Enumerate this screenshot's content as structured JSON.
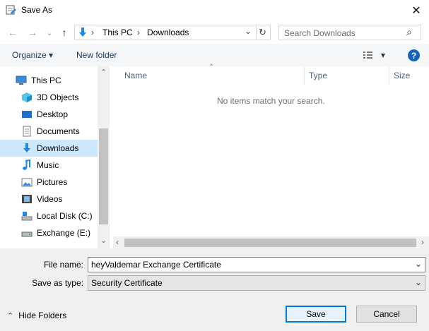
{
  "window": {
    "title": "Save As",
    "close_glyph": "✕"
  },
  "nav": {
    "back_glyph": "←",
    "forward_glyph": "→",
    "recent_glyph": "⌄",
    "up_glyph": "↑",
    "breadcrumb": [
      "This PC",
      "Downloads"
    ],
    "breadcrumb_sep": "›",
    "dropdown_glyph": "⌄",
    "refresh_glyph": "↻",
    "search_placeholder": "Search Downloads",
    "search_glyph": "⌕"
  },
  "toolbar": {
    "organize_label": "Organize",
    "organize_arrow": "▾",
    "new_folder_label": "New folder",
    "view_arrow": "▾",
    "help_glyph": "?"
  },
  "sidebar": {
    "items": [
      {
        "label": "This PC",
        "icon": "computer-icon"
      },
      {
        "label": "3D Objects",
        "icon": "cube-icon"
      },
      {
        "label": "Desktop",
        "icon": "desktop-icon"
      },
      {
        "label": "Documents",
        "icon": "document-icon"
      },
      {
        "label": "Downloads",
        "icon": "download-arrow-icon",
        "selected": true
      },
      {
        "label": "Music",
        "icon": "music-note-icon"
      },
      {
        "label": "Pictures",
        "icon": "picture-icon"
      },
      {
        "label": "Videos",
        "icon": "video-icon"
      },
      {
        "label": "Local Disk (C:)",
        "icon": "local-disk-icon"
      },
      {
        "label": "Exchange (E:)",
        "icon": "drive-icon"
      }
    ],
    "scroll_up_glyph": "⌃",
    "scroll_down_glyph": "⌄"
  },
  "filelist": {
    "columns": [
      "Name",
      "Type",
      "Size"
    ],
    "sort_glyph": "⌃",
    "empty_message": "No items match your search.",
    "scroll_left_glyph": "‹",
    "scroll_right_glyph": "›"
  },
  "form": {
    "filename_label": "File name:",
    "filename_value": "heyValdemar Exchange Certificate",
    "savetype_label": "Save as type:",
    "savetype_value": "Security Certificate",
    "combo_glyph": "⌄"
  },
  "footer": {
    "hide_folders_glyph": "⌃",
    "hide_folders_label": "Hide Folders",
    "save_label": "Save",
    "cancel_label": "Cancel"
  },
  "colors": {
    "accent": "#0078d7",
    "selection": "#cce8ff",
    "toolbar_text": "#1e395b",
    "help_blue": "#1565c0"
  }
}
